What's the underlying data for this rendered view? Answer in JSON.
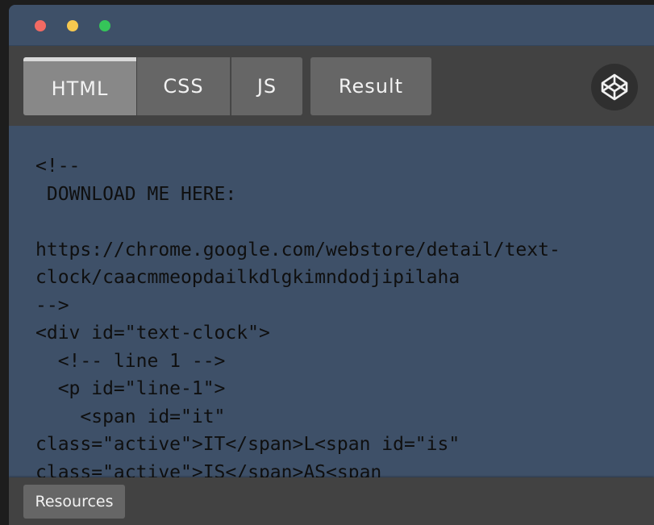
{
  "window": {
    "traffic_lights": [
      "close",
      "minimize",
      "zoom"
    ]
  },
  "tabs": {
    "html": "HTML",
    "css": "CSS",
    "js": "JS",
    "result": "Result",
    "active": "HTML"
  },
  "logo_icon": "codepen-cube-icon",
  "editor": {
    "lines": [
      "<!--",
      " DOWNLOAD ME HERE:",
      "",
      "https://chrome.google.com/webstore/detail/text-",
      "clock/caacmmeopdailkdlgkimndodjipilaha",
      "-->",
      "<div id=\"text-clock\">",
      "  <!-- line 1 -->",
      "  <p id=\"line-1\">",
      "    <span id=\"it\"",
      "class=\"active\">IT</span>L<span id=\"is\"",
      "class=\"active\">IS</span>AS<span"
    ]
  },
  "footer": {
    "resources_label": "Resources"
  },
  "colors": {
    "panel_blue": "#3e5068",
    "toolbar_gray": "#424242",
    "tab_gray": "#666666",
    "tab_active": "#888888"
  }
}
